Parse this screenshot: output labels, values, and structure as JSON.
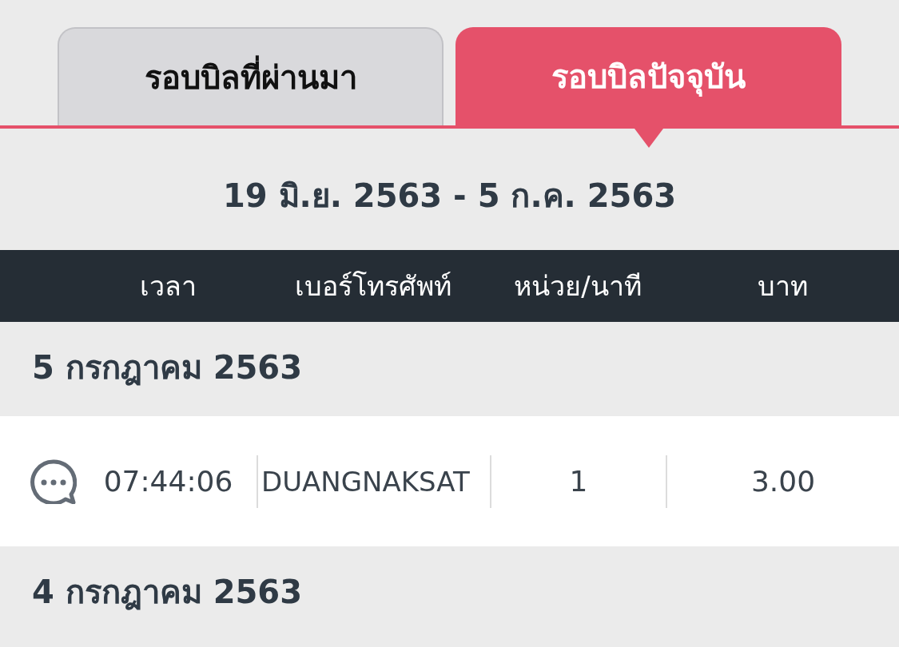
{
  "tabs": [
    {
      "label": "รอบบิลที่ผ่านมา",
      "selected": false
    },
    {
      "label": "รอบบิลปัจจุบัน",
      "selected": true
    }
  ],
  "period": "19 มิ.ย. 2563 - 5 ก.ค. 2563",
  "columns": [
    "เวลา",
    "เบอร์โทรศัพท์",
    "หน่วย/นาที",
    "บาท"
  ],
  "groups": [
    {
      "date": "5 กรกฎาคม 2563",
      "entries": [
        {
          "kind": "sms",
          "time": "07:44:06",
          "number": "DUANGNAKSAT",
          "units": "1",
          "amount": "3.00"
        }
      ]
    },
    {
      "date": "4 กรกฎาคม 2563"
    }
  ]
}
